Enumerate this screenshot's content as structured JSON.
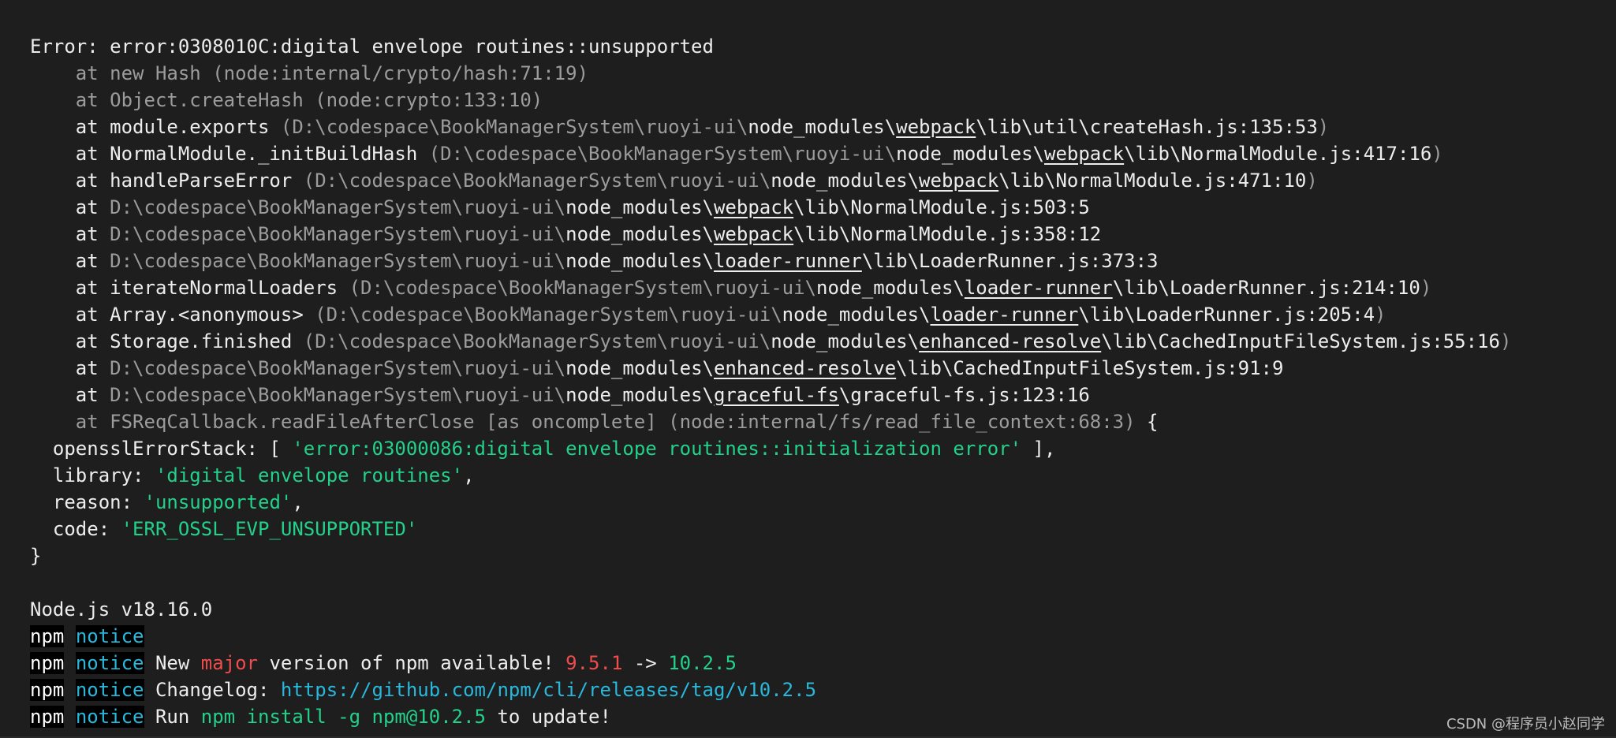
{
  "colors": {
    "background": "#1e1e1e",
    "text": "#e6e6e6",
    "dim": "#9c9c9c",
    "string": "#23d18b",
    "notice": "#29b8db",
    "highlight_red": "#f14c4c"
  },
  "terminal": {
    "lines": [
      [
        {
          "t": "Error: error:0308010C:digital envelope routines::unsupported",
          "c": "bright"
        }
      ],
      [
        {
          "t": "    at new Hash (node:internal/crypto/hash:71:19)",
          "c": "grey"
        }
      ],
      [
        {
          "t": "    at Object.createHash (node:crypto:133:10)",
          "c": "grey"
        }
      ],
      [
        {
          "t": "    at module.exports ",
          "c": "bright"
        },
        {
          "t": "(D:\\codespace\\BookManagerSystem\\ruoyi-ui\\",
          "c": "grey"
        },
        {
          "t": "node_modules\\",
          "c": "bright"
        },
        {
          "t": "webpack",
          "c": "bright",
          "u": true
        },
        {
          "t": "\\lib\\util\\createHash.js:135:53",
          "c": "bright"
        },
        {
          "t": ")",
          "c": "grey"
        }
      ],
      [
        {
          "t": "    at NormalModule._initBuildHash ",
          "c": "bright"
        },
        {
          "t": "(D:\\codespace\\BookManagerSystem\\ruoyi-ui\\",
          "c": "grey"
        },
        {
          "t": "node_modules\\",
          "c": "bright"
        },
        {
          "t": "webpack",
          "c": "bright",
          "u": true
        },
        {
          "t": "\\lib\\NormalModule.js:417:16",
          "c": "bright"
        },
        {
          "t": ")",
          "c": "grey"
        }
      ],
      [
        {
          "t": "    at handleParseError ",
          "c": "bright"
        },
        {
          "t": "(D:\\codespace\\BookManagerSystem\\ruoyi-ui\\",
          "c": "grey"
        },
        {
          "t": "node_modules\\",
          "c": "bright"
        },
        {
          "t": "webpack",
          "c": "bright",
          "u": true
        },
        {
          "t": "\\lib\\NormalModule.js:471:10",
          "c": "bright"
        },
        {
          "t": ")",
          "c": "grey"
        }
      ],
      [
        {
          "t": "    at ",
          "c": "bright"
        },
        {
          "t": "D:\\codespace\\BookManagerSystem\\ruoyi-ui\\",
          "c": "grey"
        },
        {
          "t": "node_modules\\",
          "c": "bright"
        },
        {
          "t": "webpack",
          "c": "bright",
          "u": true
        },
        {
          "t": "\\lib\\NormalModule.js:503:5",
          "c": "bright"
        }
      ],
      [
        {
          "t": "    at ",
          "c": "bright"
        },
        {
          "t": "D:\\codespace\\BookManagerSystem\\ruoyi-ui\\",
          "c": "grey"
        },
        {
          "t": "node_modules\\",
          "c": "bright"
        },
        {
          "t": "webpack",
          "c": "bright",
          "u": true
        },
        {
          "t": "\\lib\\NormalModule.js:358:12",
          "c": "bright"
        }
      ],
      [
        {
          "t": "    at ",
          "c": "bright"
        },
        {
          "t": "D:\\codespace\\BookManagerSystem\\ruoyi-ui\\",
          "c": "grey"
        },
        {
          "t": "node_modules\\",
          "c": "bright"
        },
        {
          "t": "loader-runner",
          "c": "bright",
          "u": true
        },
        {
          "t": "\\lib\\LoaderRunner.js:373:3",
          "c": "bright"
        }
      ],
      [
        {
          "t": "    at iterateNormalLoaders ",
          "c": "bright"
        },
        {
          "t": "(D:\\codespace\\BookManagerSystem\\ruoyi-ui\\",
          "c": "grey"
        },
        {
          "t": "node_modules\\",
          "c": "bright"
        },
        {
          "t": "loader-runner",
          "c": "bright",
          "u": true
        },
        {
          "t": "\\lib\\LoaderRunner.js:214:10",
          "c": "bright"
        },
        {
          "t": ")",
          "c": "grey"
        }
      ],
      [
        {
          "t": "    at Array.<anonymous> ",
          "c": "bright"
        },
        {
          "t": "(D:\\codespace\\BookManagerSystem\\ruoyi-ui\\",
          "c": "grey"
        },
        {
          "t": "node_modules\\",
          "c": "bright"
        },
        {
          "t": "loader-runner",
          "c": "bright",
          "u": true
        },
        {
          "t": "\\lib\\LoaderRunner.js:205:4",
          "c": "bright"
        },
        {
          "t": ")",
          "c": "grey"
        }
      ],
      [
        {
          "t": "    at Storage.finished ",
          "c": "bright"
        },
        {
          "t": "(D:\\codespace\\BookManagerSystem\\ruoyi-ui\\",
          "c": "grey"
        },
        {
          "t": "node_modules\\",
          "c": "bright"
        },
        {
          "t": "enhanced-resolve",
          "c": "bright",
          "u": true
        },
        {
          "t": "\\lib\\CachedInputFileSystem.js:55:16",
          "c": "bright"
        },
        {
          "t": ")",
          "c": "grey"
        }
      ],
      [
        {
          "t": "    at ",
          "c": "bright"
        },
        {
          "t": "D:\\codespace\\BookManagerSystem\\ruoyi-ui\\",
          "c": "grey"
        },
        {
          "t": "node_modules\\",
          "c": "bright"
        },
        {
          "t": "enhanced-resolve",
          "c": "bright",
          "u": true
        },
        {
          "t": "\\lib\\CachedInputFileSystem.js:91:9",
          "c": "bright"
        }
      ],
      [
        {
          "t": "    at ",
          "c": "bright"
        },
        {
          "t": "D:\\codespace\\BookManagerSystem\\ruoyi-ui\\",
          "c": "grey"
        },
        {
          "t": "node_modules\\",
          "c": "bright"
        },
        {
          "t": "graceful-fs",
          "c": "bright",
          "u": true
        },
        {
          "t": "\\graceful-fs.js:123:16",
          "c": "bright"
        }
      ],
      [
        {
          "t": "    at FSReqCallback.readFileAfterClose [as oncomplete] (node:internal/fs/read_file_context:68:3)",
          "c": "grey"
        },
        {
          "t": " {",
          "c": "bright"
        }
      ],
      [
        {
          "t": "  opensslErrorStack: [ ",
          "c": "bright"
        },
        {
          "t": "'error:03000086:digital envelope routines::initialization error'",
          "c": "green"
        },
        {
          "t": " ],",
          "c": "bright"
        }
      ],
      [
        {
          "t": "  library: ",
          "c": "bright"
        },
        {
          "t": "'digital envelope routines'",
          "c": "green"
        },
        {
          "t": ",",
          "c": "bright"
        }
      ],
      [
        {
          "t": "  reason: ",
          "c": "bright"
        },
        {
          "t": "'unsupported'",
          "c": "green"
        },
        {
          "t": ",",
          "c": "bright"
        }
      ],
      [
        {
          "t": "  code: ",
          "c": "bright"
        },
        {
          "t": "'ERR_OSSL_EVP_UNSUPPORTED'",
          "c": "green"
        }
      ],
      [
        {
          "t": "}",
          "c": "bright"
        }
      ],
      [],
      [
        {
          "t": "Node.js v18.16.0",
          "c": "bright"
        }
      ],
      [
        {
          "t": "npm",
          "c": "npm"
        },
        {
          "t": " ",
          "c": "bright"
        },
        {
          "t": "notice",
          "c": "notice"
        }
      ],
      [
        {
          "t": "npm",
          "c": "npm"
        },
        {
          "t": " ",
          "c": "bright"
        },
        {
          "t": "notice",
          "c": "notice"
        },
        {
          "t": " New ",
          "c": "bright"
        },
        {
          "t": "major",
          "c": "red"
        },
        {
          "t": " version of npm available! ",
          "c": "bright"
        },
        {
          "t": "9.5.1",
          "c": "red"
        },
        {
          "t": " -> ",
          "c": "bright"
        },
        {
          "t": "10.2.5",
          "c": "green"
        }
      ],
      [
        {
          "t": "npm",
          "c": "npm"
        },
        {
          "t": " ",
          "c": "bright"
        },
        {
          "t": "notice",
          "c": "notice"
        },
        {
          "t": " Changelog: ",
          "c": "bright"
        },
        {
          "t": "https://github.com/npm/cli/releases/tag/v10.2.5",
          "c": "cyan"
        }
      ],
      [
        {
          "t": "npm",
          "c": "npm"
        },
        {
          "t": " ",
          "c": "bright"
        },
        {
          "t": "notice",
          "c": "notice"
        },
        {
          "t": " Run ",
          "c": "bright"
        },
        {
          "t": "npm install -g npm@10.2.5",
          "c": "green"
        },
        {
          "t": " to update!",
          "c": "bright"
        }
      ]
    ]
  },
  "watermark": "CSDN @程序员小赵同学"
}
